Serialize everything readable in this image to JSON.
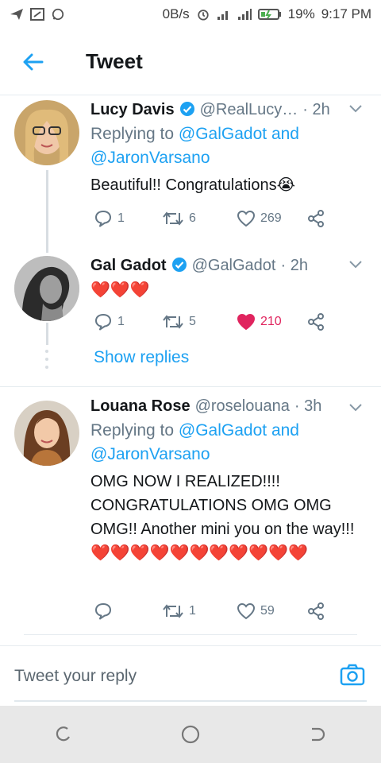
{
  "status_bar": {
    "network_speed": "0B/s",
    "battery": "19%",
    "time": "9:17 PM"
  },
  "header": {
    "title": "Tweet"
  },
  "tweets": [
    {
      "name": "Lucy Davis",
      "handle": "@RealLucy…",
      "time": "· 2h",
      "replying_prefix": "Replying to ",
      "reply_line1": "@GalGadot and",
      "reply_line2": "@JaronVarsano",
      "text": "Beautiful!! Congratulations😭",
      "replies": "1",
      "retweets": "6",
      "likes": "269"
    },
    {
      "name": "Gal Gadot",
      "handle": "@GalGadot",
      "time": "· 2h",
      "text": "❤️❤️❤️",
      "replies": "1",
      "retweets": "5",
      "likes": "210"
    },
    {
      "name": "Louana Rose",
      "handle": "@roselouana",
      "time": "· 3h",
      "replying_prefix": "Replying to ",
      "reply_line1": "@GalGadot and",
      "reply_line2": "@JaronVarsano",
      "text": "OMG NOW I REALIZED!!!! CONGRATULATIONS OMG OMG OMG!! Another mini you on the way!!! ❤️❤️❤️❤️❤️❤️❤️❤️❤️❤️❤️",
      "replies": "",
      "retweets": "1",
      "likes": "59"
    }
  ],
  "show_replies": "Show replies",
  "reply_bar": {
    "placeholder": "Tweet your reply"
  },
  "colors": {
    "accent": "#1da1f2",
    "liked": "#e0245e",
    "muted": "#657786"
  }
}
